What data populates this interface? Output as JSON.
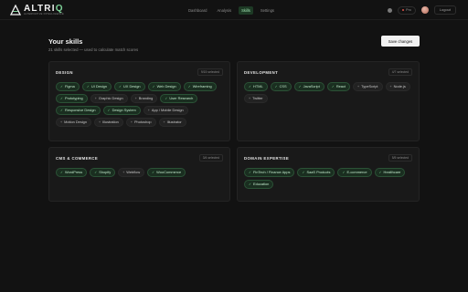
{
  "brand": {
    "name_main": "ALTRI",
    "name_accent": "Q",
    "tagline": "ALTERNATIVE INTELLIGENCE"
  },
  "nav": [
    {
      "label": "Dashboard",
      "active": false
    },
    {
      "label": "Analysis",
      "active": false
    },
    {
      "label": "Skills",
      "active": true
    },
    {
      "label": "Settings",
      "active": false
    }
  ],
  "header": {
    "pro_label": "Pro",
    "logout_label": "Logout"
  },
  "page": {
    "title": "Your skills",
    "subtitle": "21 skills selected — used to calculate match scores",
    "save_label": "Save changes"
  },
  "sections": [
    {
      "title": "DESIGN",
      "count": "9/15 selected",
      "skills": [
        {
          "label": "Figma",
          "selected": true
        },
        {
          "label": "UI Design",
          "selected": true
        },
        {
          "label": "UX Design",
          "selected": true
        },
        {
          "label": "Web Design",
          "selected": true
        },
        {
          "label": "Wireframing",
          "selected": true
        },
        {
          "label": "Prototyping",
          "selected": true
        },
        {
          "label": "Graphic Design",
          "selected": false
        },
        {
          "label": "Branding",
          "selected": false
        },
        {
          "label": "User Research",
          "selected": true
        },
        {
          "label": "Responsive Design",
          "selected": true
        },
        {
          "label": "Design System",
          "selected": true
        },
        {
          "label": "App / Mobile Design",
          "selected": false
        },
        {
          "label": "Motion Design",
          "selected": false
        },
        {
          "label": "Illustration",
          "selected": false
        },
        {
          "label": "Photoshop",
          "selected": false
        },
        {
          "label": "Illustrator",
          "selected": false
        }
      ]
    },
    {
      "title": "DEVELOPMENT",
      "count": "4/7 selected",
      "skills": [
        {
          "label": "HTML",
          "selected": true
        },
        {
          "label": "CSS",
          "selected": true
        },
        {
          "label": "JavaScript",
          "selected": true
        },
        {
          "label": "React",
          "selected": true
        },
        {
          "label": "TypeScript",
          "selected": false
        },
        {
          "label": "Node.js",
          "selected": false
        },
        {
          "label": "Twitter",
          "selected": false
        }
      ]
    },
    {
      "title": "CMS & COMMERCE",
      "count": "3/4 selected",
      "skills": [
        {
          "label": "WordPress",
          "selected": true
        },
        {
          "label": "Shopify",
          "selected": true
        },
        {
          "label": "Webflow",
          "selected": false
        },
        {
          "label": "WooCommerce",
          "selected": true
        }
      ]
    },
    {
      "title": "DOMAIN EXPERTISE",
      "count": "5/5 selected",
      "skills": [
        {
          "label": "FinTech / Finance Apps",
          "selected": true
        },
        {
          "label": "SaaS Products",
          "selected": true
        },
        {
          "label": "E-commerce",
          "selected": true
        },
        {
          "label": "Healthcare",
          "selected": true
        },
        {
          "label": "Education",
          "selected": true
        }
      ]
    }
  ],
  "colors": {
    "background": "#121212",
    "card": "#191919",
    "accent": "#79d48f",
    "chip_selected": "#1a2e20"
  }
}
